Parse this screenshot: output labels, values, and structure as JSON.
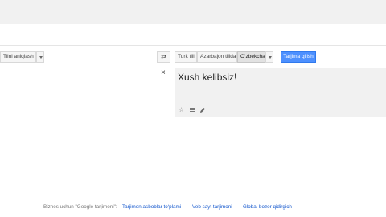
{
  "source": {
    "detect_label": "Tilni aniqlash",
    "clear_icon": "×"
  },
  "target": {
    "languages": [
      "Turk tili",
      "Azarbajon tilida",
      "O‘zbekcha"
    ],
    "translate_label": "Tarjima qilish",
    "result_text": "Xush kelibsiz!"
  },
  "footer": {
    "business_label": "Biznes uchun \"Google tarjimoni\":",
    "links": [
      "Tarjimon asboblar to‘plami",
      "Veb sayt tarjimoni",
      "Global bozor qidirgich"
    ]
  },
  "icons": {
    "swap": "swap-languages-icon",
    "star": "star-icon",
    "list": "list-icon",
    "edit": "pencil-icon"
  },
  "colors": {
    "accent": "#4d90fe",
    "link": "#1155cc"
  }
}
